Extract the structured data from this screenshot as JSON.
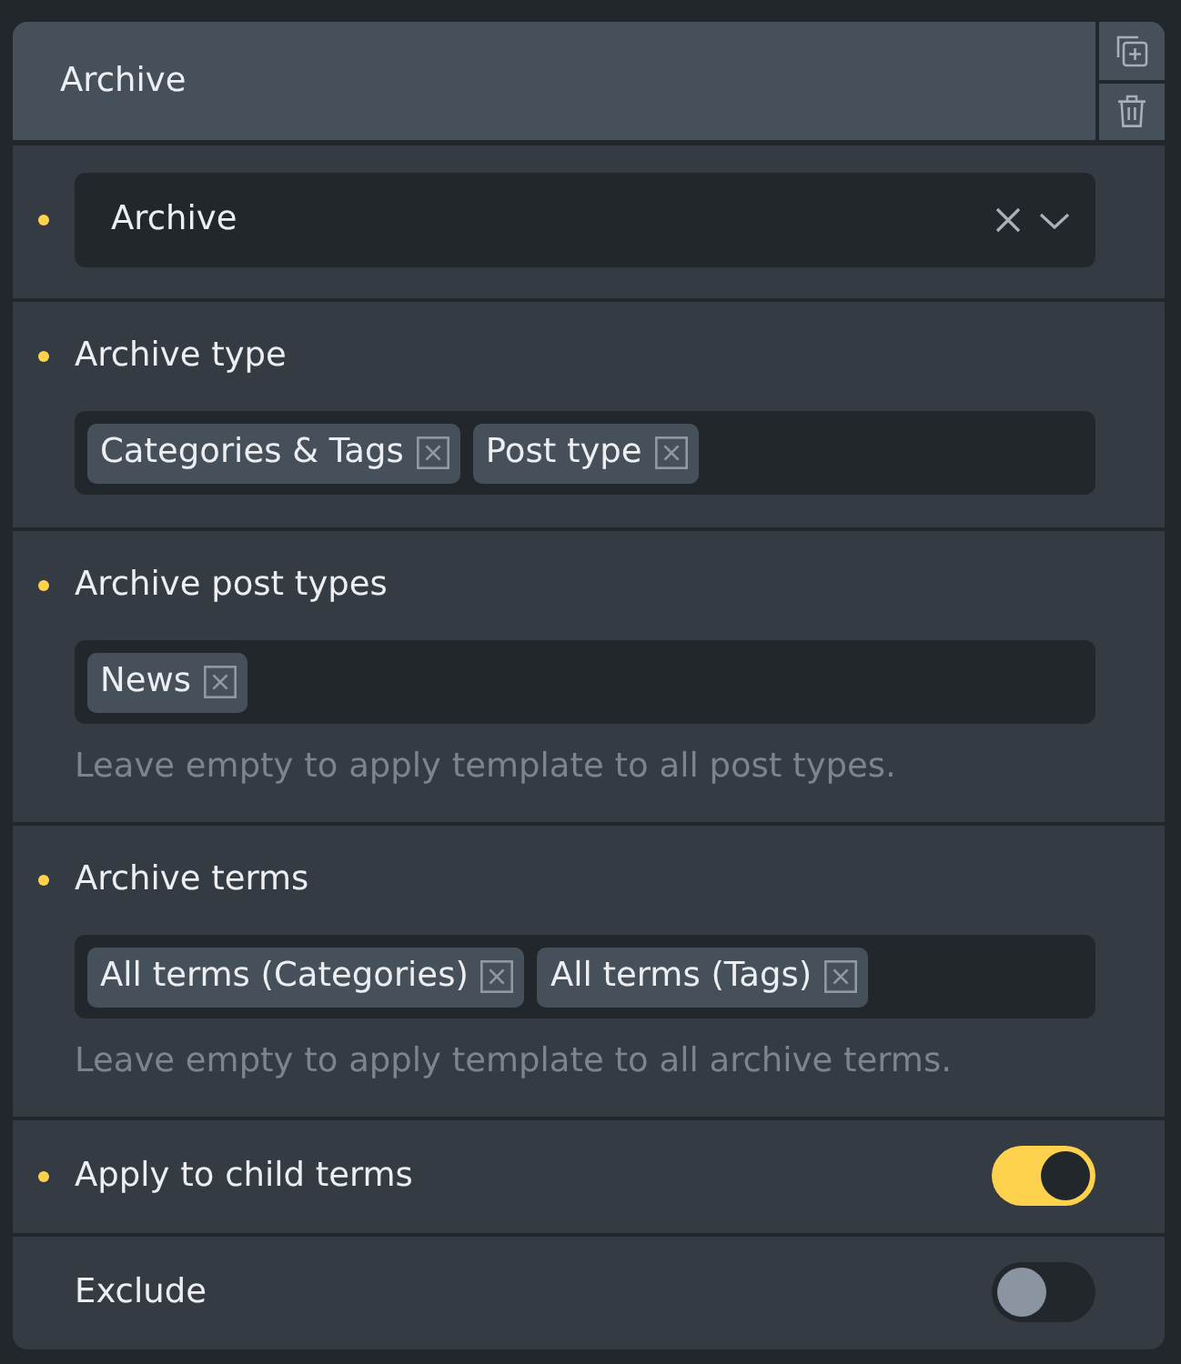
{
  "panel": {
    "title": "Archive"
  },
  "settings": [
    {
      "kind": "select",
      "modified": true,
      "value": "Archive"
    },
    {
      "kind": "tags",
      "modified": true,
      "label": "Archive type",
      "tags": [
        "Categories & Tags",
        "Post type"
      ]
    },
    {
      "kind": "tags",
      "modified": true,
      "label": "Archive post types",
      "tags": [
        "News"
      ],
      "help": "Leave empty to apply template to all post types."
    },
    {
      "kind": "tags",
      "modified": true,
      "label": "Archive terms",
      "tags": [
        "All terms (Categories)",
        "All terms (Tags)"
      ],
      "help": "Leave empty to apply template to all archive terms."
    },
    {
      "kind": "toggle",
      "modified": true,
      "label": "Apply to child terms",
      "on": true
    },
    {
      "kind": "toggle",
      "modified": false,
      "label": "Exclude",
      "on": false
    }
  ]
}
